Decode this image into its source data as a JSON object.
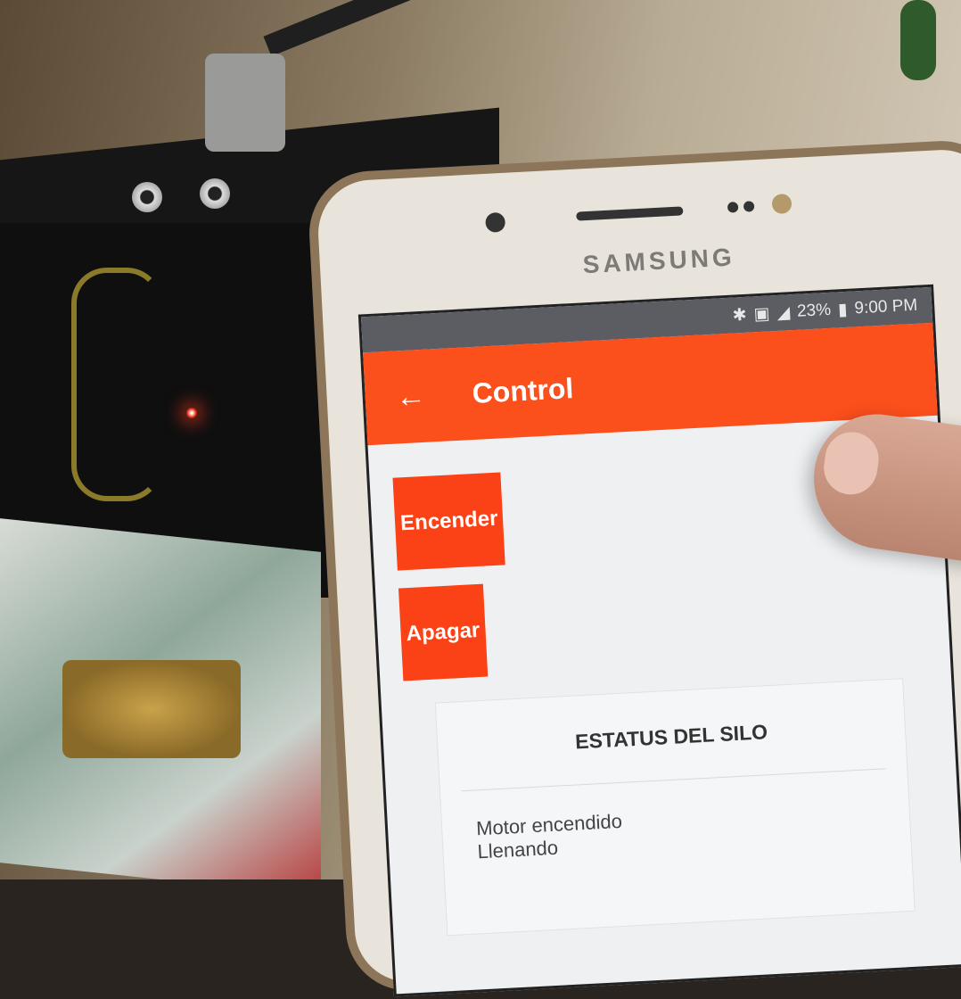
{
  "phone": {
    "brand": "SAMSUNG",
    "status_bar": {
      "battery": "23%",
      "time": "9:00 PM"
    }
  },
  "app": {
    "title": "Control",
    "buttons": {
      "on_label": "Encender",
      "off_label": "Apagar"
    },
    "status_card": {
      "title": "ESTATUS DEL SILO",
      "lines": [
        "Motor encendido",
        "Llenando"
      ]
    },
    "colors": {
      "accent": "#fb4f1c",
      "button": "#fb4116"
    }
  }
}
